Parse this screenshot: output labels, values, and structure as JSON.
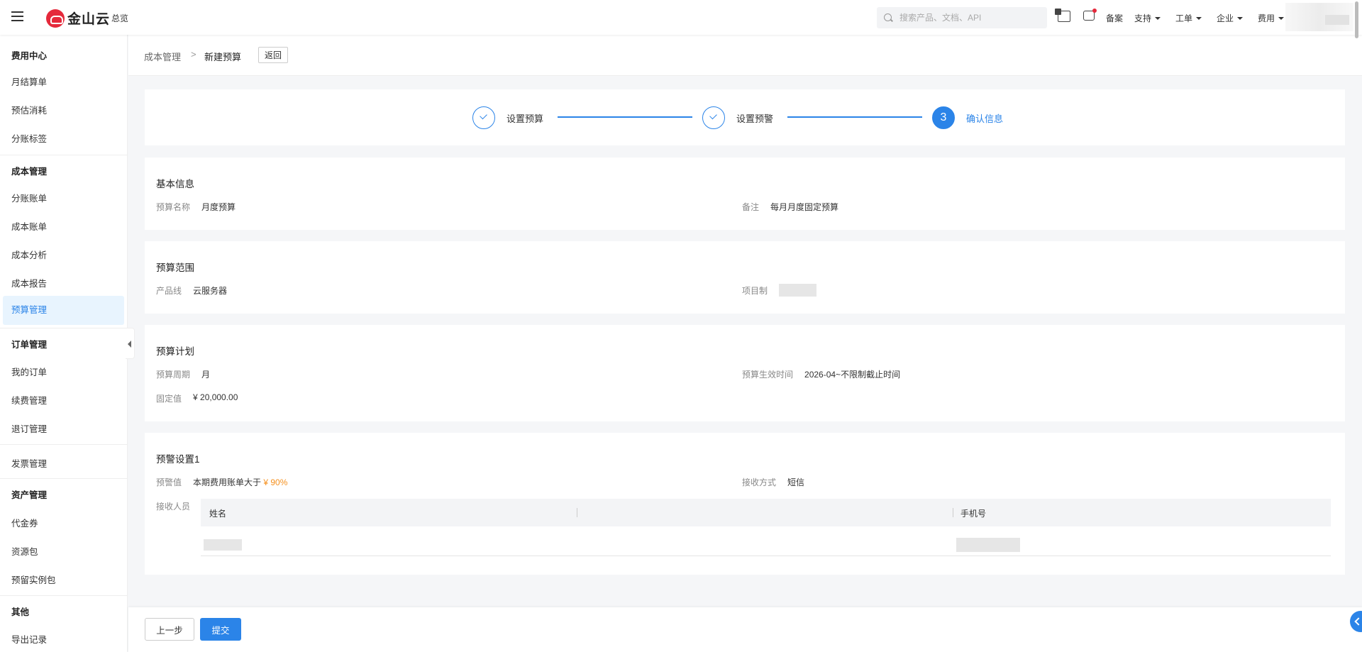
{
  "topbar": {
    "brand": "金山云",
    "overview": "总览",
    "search_placeholder": "搜索产品、文档、API",
    "links": {
      "filing": "备案",
      "support": "支持",
      "ticket": "工单",
      "enterprise": "企业",
      "billing": "费用"
    }
  },
  "sidebar": {
    "groups": {
      "fees": "费用中心",
      "cost": "成本管理",
      "orders": "订单管理",
      "assets": "资产管理",
      "others": "其他"
    },
    "items": {
      "monthly_bill": "月结算单",
      "estimated": "预估消耗",
      "split_tag": "分账标签",
      "split_bill": "分账账单",
      "cost_bill": "成本账单",
      "cost_analysis": "成本分析",
      "cost_report": "成本报告",
      "budget_mgmt": "预算管理",
      "my_orders": "我的订单",
      "renewal": "续费管理",
      "unsubscribe": "退订管理",
      "invoice": "发票管理",
      "voucher": "代金券",
      "resource_pack": "资源包",
      "reserved": "预留实例包",
      "export": "导出记录"
    }
  },
  "breadcrumb": {
    "parent": "成本管理",
    "separator": ">",
    "current": "新建预算",
    "back": "返回"
  },
  "steps": [
    {
      "label": "设置预算",
      "status": "done"
    },
    {
      "label": "设置预警",
      "status": "done"
    },
    {
      "label": "确认信息",
      "status": "current",
      "number": "3"
    }
  ],
  "basic": {
    "title": "基本信息",
    "name_label": "预算名称",
    "name_value": "月度预算",
    "note_label": "备注",
    "note_value": "每月月度固定预算"
  },
  "scope": {
    "title": "预算范围",
    "product_label": "产品线",
    "product_value": "云服务器",
    "project_label": "项目制"
  },
  "plan": {
    "title": "预算计划",
    "period_label": "预算周期",
    "period_value": "月",
    "effective_label": "预算生效时间",
    "effective_value": "2026-04~不限制截止时间",
    "fixed_label": "固定值",
    "fixed_value": "¥ 20,000.00"
  },
  "alert": {
    "title": "预警设置1",
    "threshold_label": "预警值",
    "threshold_text": "本期费用账单大于",
    "threshold_value": "¥ 90%",
    "method_label": "接收方式",
    "method_value": "短信",
    "receivers_label": "接收人员",
    "columns": [
      "姓名",
      "",
      "手机号"
    ]
  },
  "footer": {
    "prev": "上一步",
    "submit": "提交"
  },
  "colors": {
    "accent": "#2b84e8",
    "brand": "#e5293b",
    "highlight": "#f5901e"
  }
}
